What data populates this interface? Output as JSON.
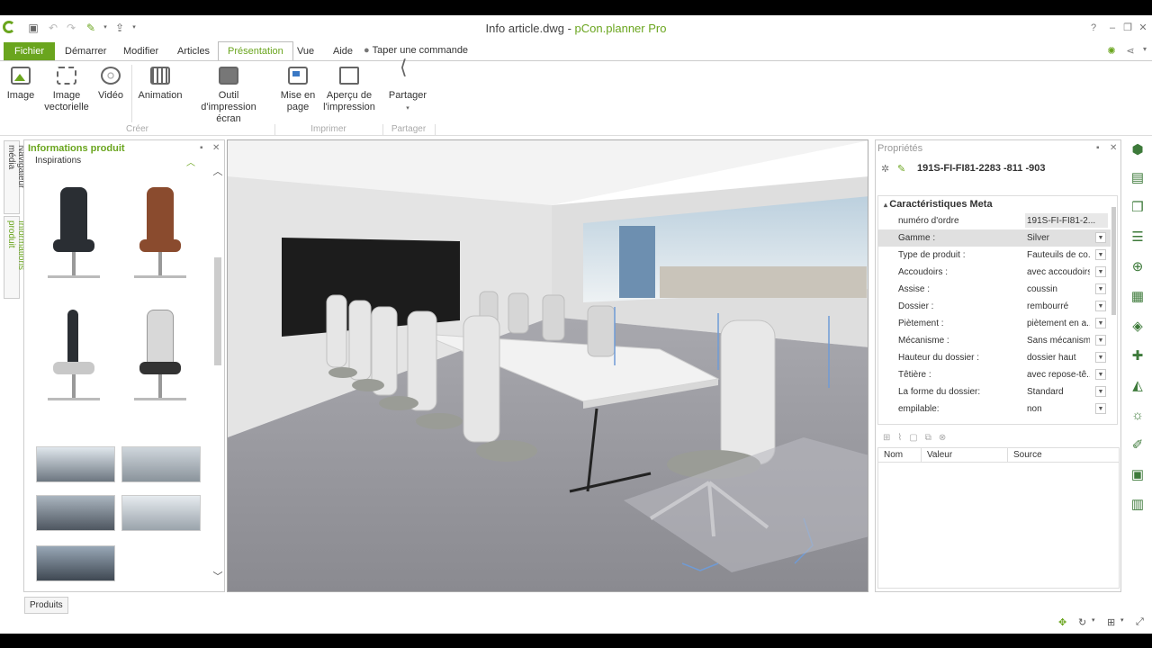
{
  "window": {
    "title_file": "Info article.dwg",
    "title_sep": " - ",
    "title_app": "pCon.planner Pro"
  },
  "menu": {
    "file": "Fichier",
    "tabs": [
      "Démarrer",
      "Modifier",
      "Articles",
      "Présentation",
      "Vue",
      "Aide"
    ],
    "active_tab": "Présentation",
    "command_search": "Taper une commande"
  },
  "ribbon": {
    "buttons": {
      "image": "Image",
      "image_vectorielle_1": "Image",
      "image_vectorielle_2": "vectorielle",
      "video": "Vidéo",
      "animation": "Animation",
      "outil_1": "Outil d'impression",
      "outil_2": "écran",
      "mise_1": "Mise en",
      "mise_2": "page",
      "apercu_1": "Aperçu de",
      "apercu_2": "l'impression",
      "partager": "Partager"
    },
    "groups": {
      "creer": "Créer",
      "imprimer": "Imprimer",
      "partager": "Partager"
    }
  },
  "side_tabs": {
    "navigator": "Navigateur média",
    "product_info": "Informations produit"
  },
  "product_panel": {
    "title": "Informations produit",
    "section": "Inspirations"
  },
  "properties": {
    "title": "Propriétés",
    "article_id": "191S-FI-FI81-2283  -811   -903",
    "section": "Caractéristiques Meta",
    "rows": [
      {
        "label": "numéro d'ordre",
        "value": "191S-FI-FI81-2..."
      },
      {
        "label": "Gamme :",
        "value": "Silver"
      },
      {
        "label": "Type de produit :",
        "value": "Fauteuils de co..."
      },
      {
        "label": "Accoudoirs :",
        "value": "avec accoudoirs"
      },
      {
        "label": "Assise :",
        "value": "coussin"
      },
      {
        "label": "Dossier :",
        "value": "rembourré"
      },
      {
        "label": "Piètement :",
        "value": "piètement en a..."
      },
      {
        "label": "Mécanisme :",
        "value": "Sans mécanisme"
      },
      {
        "label": "Hauteur du dossier :",
        "value": "dossier haut"
      },
      {
        "label": "Têtière :",
        "value": "avec repose-tê..."
      },
      {
        "label": "La forme du dossier:",
        "value": "Standard"
      },
      {
        "label": "empilable:",
        "value": "non"
      }
    ],
    "table_headers": [
      "Nom",
      "Valeur",
      "Source"
    ]
  },
  "bottom": {
    "produits": "Produits"
  },
  "colors": {
    "accent": "#6aa51e",
    "icon_green": "#3d7a3a"
  }
}
